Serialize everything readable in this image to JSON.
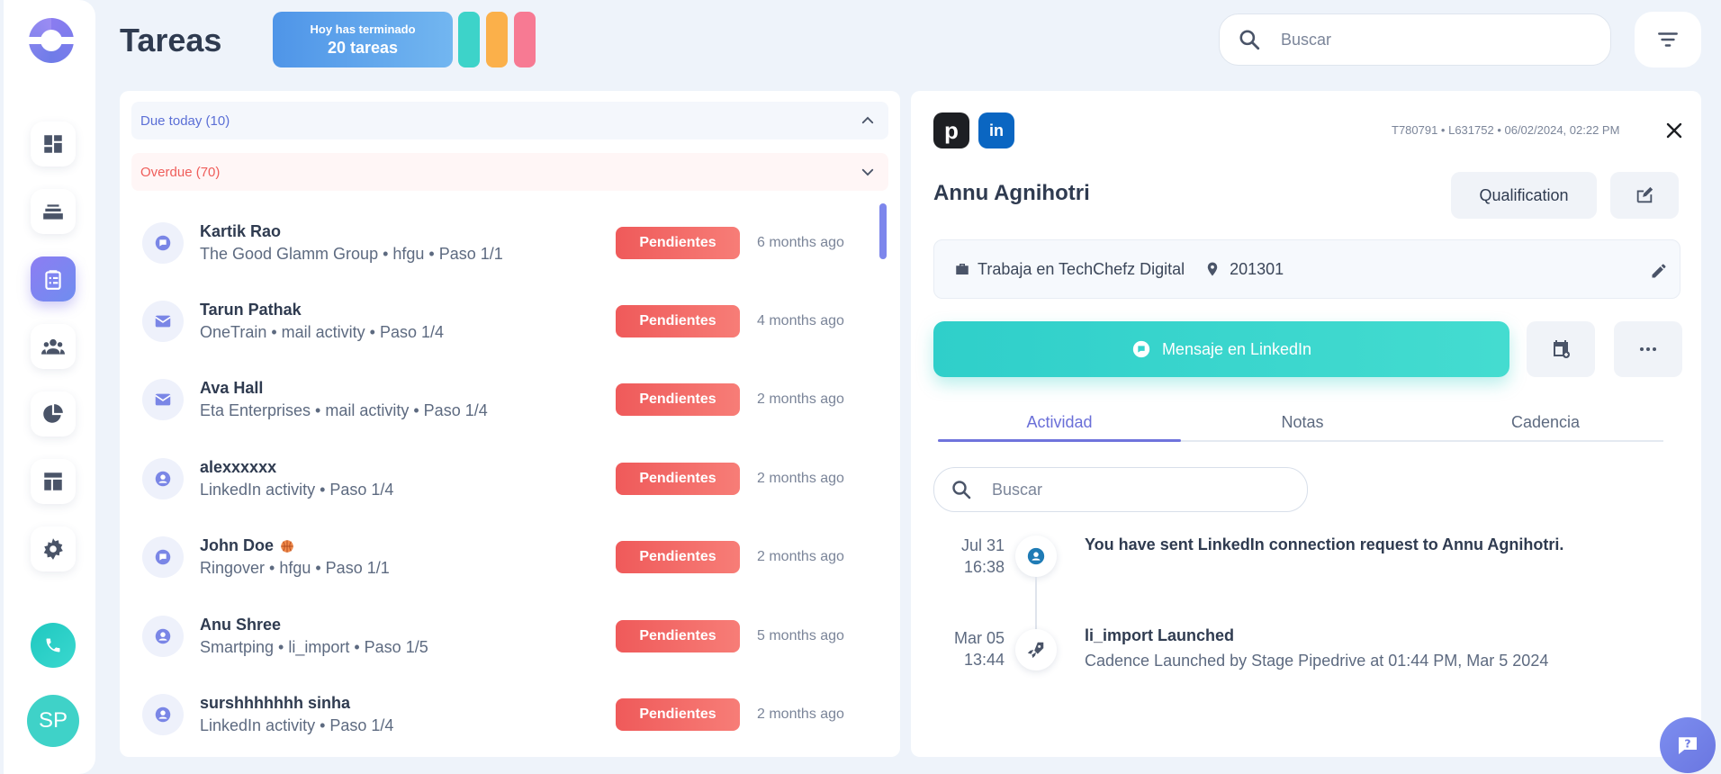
{
  "sidebar": {
    "avatar_initials": "SP",
    "items": [
      {
        "icon": "dashboard-icon"
      },
      {
        "icon": "inbox-stack-icon"
      },
      {
        "icon": "clipboard-tasks-icon",
        "active": true
      },
      {
        "icon": "people-icon"
      },
      {
        "icon": "pie-chart-icon"
      },
      {
        "icon": "layout-icon"
      },
      {
        "icon": "gear-icon"
      }
    ]
  },
  "header": {
    "title": "Tareas",
    "done_label": "Hoy has terminado",
    "done_count": "20 tareas",
    "search_placeholder": "Buscar",
    "colors": {
      "teal": "#3dd3c9",
      "orange": "#fbb04a",
      "pink": "#f77a93"
    }
  },
  "task_list": {
    "due_today": "Due today (10)",
    "overdue": "Overdue (70)",
    "tasks": [
      {
        "name": "Kartik Rao",
        "sub": "The Good Glamm Group • hfgu • Paso 1/1",
        "status": "Pendientes",
        "time": "6 months ago",
        "icon": "message-icon"
      },
      {
        "name": "Tarun Pathak",
        "sub": "OneTrain • mail activity • Paso 1/4",
        "status": "Pendientes",
        "time": "4 months ago",
        "icon": "mail-icon"
      },
      {
        "name": "Ava Hall",
        "sub": "Eta Enterprises • mail activity • Paso 1/4",
        "status": "Pendientes",
        "time": "2 months ago",
        "icon": "mail-icon"
      },
      {
        "name": "alexxxxxx",
        "sub": "LinkedIn activity • Paso 1/4",
        "status": "Pendientes",
        "time": "2 months ago",
        "icon": "person-icon"
      },
      {
        "name": "John Doe",
        "sub": "Ringover • hfgu • Paso 1/1",
        "status": "Pendientes",
        "time": "2 months ago",
        "icon": "message-icon"
      },
      {
        "name": "Anu Shree",
        "sub": "Smartping • li_import • Paso 1/5",
        "status": "Pendientes",
        "time": "5 months ago",
        "icon": "person-icon"
      },
      {
        "name": "surshhhhhhh sinha",
        "sub": "LinkedIn activity • Paso 1/4",
        "status": "Pendientes",
        "time": "2 months ago",
        "icon": "person-icon"
      }
    ]
  },
  "detail": {
    "meta": "T780791 • L631752 • 06/02/2024, 02:22 PM",
    "name": "Annu Agnihotri",
    "qualification_label": "Qualification",
    "works_at": "Trabaja en TechChefz Digital",
    "zip": "201301",
    "linkedin_button": "Mensaje en LinkedIn",
    "tabs": [
      "Actividad",
      "Notas",
      "Cadencia"
    ],
    "search_placeholder": "Buscar",
    "timeline": [
      {
        "date": "Jul 31",
        "time": "16:38",
        "title": "You have sent LinkedIn connection request to Annu Agnihotri.",
        "desc": "",
        "icon": "person-icon"
      },
      {
        "date": "Mar 05",
        "time": "13:44",
        "title": "li_import Launched",
        "desc": "Cadence Launched by Stage Pipedrive at 01:44 PM, Mar 5 2024",
        "icon": "rocket-icon"
      }
    ]
  }
}
